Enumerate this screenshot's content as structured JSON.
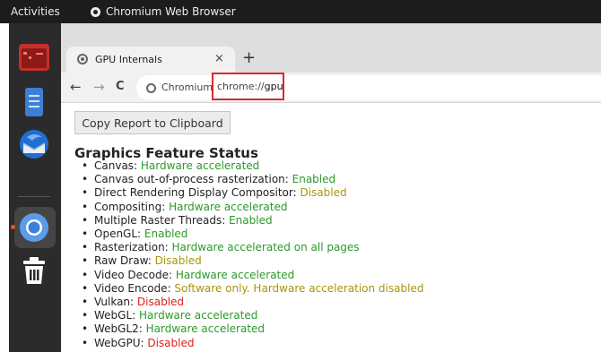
{
  "system_bar": {
    "activities": "Activities",
    "app_name": "Chromium Web Browser"
  },
  "dock": {
    "items": [
      "terminal-icon",
      "text-editor-icon",
      "thunderbird-icon",
      "chromium-icon",
      "trash-icon"
    ]
  },
  "browser": {
    "tab_title": "GPU Internals",
    "tab_close": "×",
    "new_tab": "+",
    "back": "←",
    "forward": "→",
    "reload": "C",
    "site_chip": "Chromium",
    "url_scheme": "chrome://",
    "url_host": "gpu"
  },
  "page": {
    "copy_button": "Copy Report to Clipboard",
    "section_title": "Graphics Feature Status",
    "features": [
      {
        "name": "Canvas: ",
        "status": "Hardware accelerated",
        "level": "green"
      },
      {
        "name": "Canvas out-of-process rasterization: ",
        "status": "Enabled",
        "level": "green"
      },
      {
        "name": "Direct Rendering Display Compositor: ",
        "status": "Disabled",
        "level": "yellow"
      },
      {
        "name": "Compositing: ",
        "status": "Hardware accelerated",
        "level": "green"
      },
      {
        "name": "Multiple Raster Threads: ",
        "status": "Enabled",
        "level": "green"
      },
      {
        "name": "OpenGL: ",
        "status": "Enabled",
        "level": "green"
      },
      {
        "name": "Rasterization: ",
        "status": "Hardware accelerated on all pages",
        "level": "green"
      },
      {
        "name": "Raw Draw: ",
        "status": "Disabled",
        "level": "yellow"
      },
      {
        "name": "Video Decode: ",
        "status": "Hardware accelerated",
        "level": "green"
      },
      {
        "name": "Video Encode: ",
        "status": "Software only. Hardware acceleration disabled",
        "level": "yellow"
      },
      {
        "name": "Vulkan: ",
        "status": "Disabled",
        "level": "red"
      },
      {
        "name": "WebGL: ",
        "status": "Hardware accelerated",
        "level": "green"
      },
      {
        "name": "WebGL2: ",
        "status": "Hardware accelerated",
        "level": "green"
      },
      {
        "name": "WebGPU: ",
        "status": "Disabled",
        "level": "red"
      }
    ]
  },
  "colors": {
    "green": "#2a9a2a",
    "yellow": "#a8960a",
    "red": "#e02020",
    "url_highlight": "#d42b2b"
  }
}
